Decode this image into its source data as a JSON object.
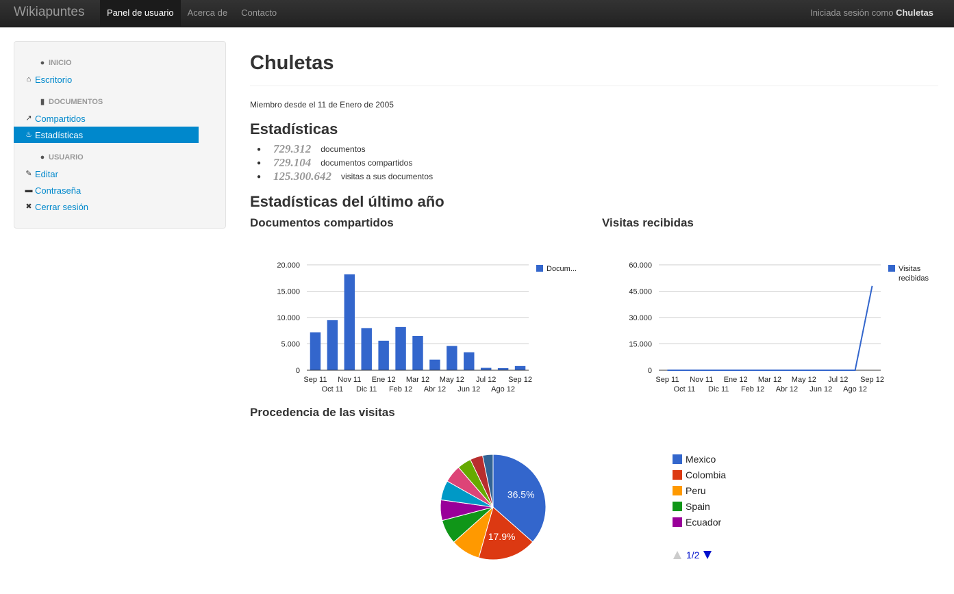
{
  "navbar": {
    "brand": "Wikiapuntes",
    "items": [
      "Panel de usuario",
      "Acerca de",
      "Contacto"
    ],
    "login_prefix": "Iniciada sesión como ",
    "login_user": "Chuletas"
  },
  "sidebar": {
    "header_inicio": "INICIO",
    "escritorio": "Escritorio",
    "header_documentos": "DOCUMENTOS",
    "compartidos": "Compartidos",
    "estadisticas": "Estadísticas",
    "header_usuario": "USUARIO",
    "editar": "Editar",
    "contrasena": "Contraseña",
    "cerrar": "Cerrar sesión"
  },
  "main": {
    "title": "Chuletas",
    "member_since": "Miembro desde el 11 de Enero de 2005",
    "stats_title": "Estadísticas",
    "stats": [
      {
        "value": "729.312",
        "label": "documentos"
      },
      {
        "value": "729.104",
        "label": "documentos compartidos"
      },
      {
        "value": "125.300.642",
        "label": "visitas a sus documentos"
      }
    ],
    "year_title": "Estadísticas del último año",
    "docs_title": "Documentos compartidos",
    "visits_title": "Visitas recibidas",
    "origin_title": "Procedencia de las visitas",
    "pager": "1/2"
  },
  "chart_data": [
    {
      "type": "bar",
      "categories": [
        "Sep 11",
        "Oct 11",
        "Nov 11",
        "Dic 11",
        "Ene 12",
        "Feb 12",
        "Mar 12",
        "Abr 12",
        "May 12",
        "Jun 12",
        "Jul 12",
        "Ago 12",
        "Sep 12"
      ],
      "series": [
        {
          "name": "Docum...",
          "values": [
            7200,
            9500,
            18200,
            8000,
            5600,
            8200,
            6500,
            2000,
            4600,
            3400,
            450,
            400,
            800
          ]
        }
      ],
      "ylim": [
        0,
        20000
      ],
      "yticks": [
        "0",
        "5.000",
        "10.000",
        "15.000",
        "20.000"
      ],
      "color": "#3366cc",
      "legend": "right"
    },
    {
      "type": "line",
      "categories": [
        "Sep 11",
        "Oct 11",
        "Nov 11",
        "Dic 11",
        "Ene 12",
        "Feb 12",
        "Mar 12",
        "Abr 12",
        "May 12",
        "Jun 12",
        "Jul 12",
        "Ago 12",
        "Sep 12"
      ],
      "series": [
        {
          "name": "Visitas recibidas",
          "values": [
            0,
            0,
            0,
            0,
            0,
            0,
            0,
            0,
            0,
            0,
            0,
            0,
            48000
          ]
        }
      ],
      "ylim": [
        0,
        60000
      ],
      "yticks": [
        "0",
        "15.000",
        "30.000",
        "45.000",
        "60.000"
      ],
      "color": "#3366cc",
      "legend": "right"
    },
    {
      "type": "pie",
      "slices": [
        {
          "name": "Mexico",
          "value": 36.5,
          "color": "#3366cc",
          "label": "36.5%"
        },
        {
          "name": "Colombia",
          "value": 17.9,
          "color": "#dc3912",
          "label": "17.9%"
        },
        {
          "name": "Peru",
          "value": 9.0,
          "color": "#ff9900"
        },
        {
          "name": "Spain",
          "value": 7.5,
          "color": "#109618"
        },
        {
          "name": "Ecuador",
          "value": 6.3,
          "color": "#990099"
        },
        {
          "name": "",
          "value": 6.0,
          "color": "#0099c6"
        },
        {
          "name": "",
          "value": 5.4,
          "color": "#dd4477"
        },
        {
          "name": "",
          "value": 4.3,
          "color": "#66aa00"
        },
        {
          "name": "",
          "value": 3.9,
          "color": "#b82e2e"
        },
        {
          "name": "",
          "value": 3.2,
          "color": "#316395"
        }
      ],
      "legend": "right"
    }
  ]
}
